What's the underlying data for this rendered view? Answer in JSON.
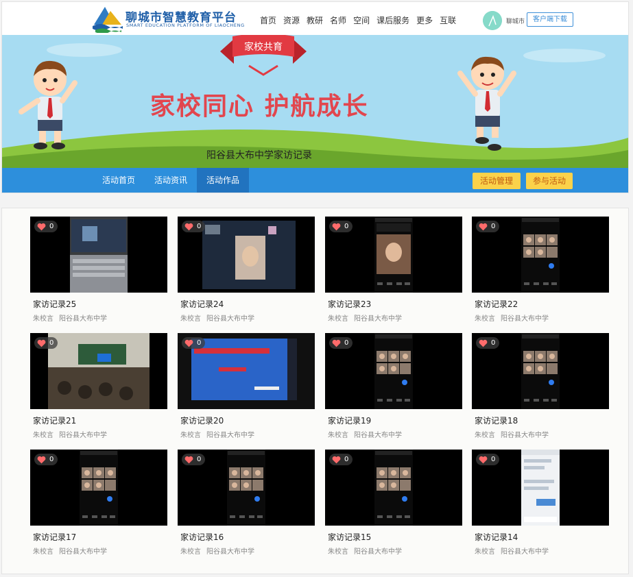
{
  "header": {
    "title": "聊城市智慧教育平台",
    "subtitle": "SMART EDUCATION PLATFORM OF LIAOCHENG",
    "nav": [
      "首页",
      "资源",
      "教研",
      "名师",
      "空间",
      "课后服务",
      "更多",
      "互联"
    ],
    "user_name": "聊城市",
    "download_label": "客户端下载"
  },
  "banner": {
    "ribbon": "家校共育",
    "title": "家校同心  护航成长",
    "subtitle": "阳谷县大布中学家访记录"
  },
  "activity_nav": {
    "tabs": [
      "活动首页",
      "活动资讯",
      "活动作品"
    ],
    "active_tab": "活动作品",
    "manage_label": "活动管理",
    "join_label": "参与活动"
  },
  "works": [
    {
      "title": "家访记录25",
      "author": "朱校言",
      "school": "阳谷县大布中学",
      "likes": "0",
      "thumb": "laptop"
    },
    {
      "title": "家访记录24",
      "author": "朱校言",
      "school": "阳谷县大布中学",
      "likes": "0",
      "thumb": "screen"
    },
    {
      "title": "家访记录23",
      "author": "朱校言",
      "school": "阳谷县大布中学",
      "likes": "0",
      "thumb": "phone-face"
    },
    {
      "title": "家访记录22",
      "author": "朱校言",
      "school": "阳谷县大布中学",
      "likes": "0",
      "thumb": "phone-grid"
    },
    {
      "title": "家访记录21",
      "author": "朱校言",
      "school": "阳谷县大布中学",
      "likes": "0",
      "thumb": "classroom"
    },
    {
      "title": "家访记录20",
      "author": "朱校言",
      "school": "阳谷县大布中学",
      "likes": "0",
      "thumb": "slide"
    },
    {
      "title": "家访记录19",
      "author": "朱校言",
      "school": "阳谷县大布中学",
      "likes": "0",
      "thumb": "phone-grid"
    },
    {
      "title": "家访记录18",
      "author": "朱校言",
      "school": "阳谷县大布中学",
      "likes": "0",
      "thumb": "phone-grid"
    },
    {
      "title": "家访记录17",
      "author": "朱校言",
      "school": "阳谷县大布中学",
      "likes": "0",
      "thumb": "phone-grid"
    },
    {
      "title": "家访记录16",
      "author": "朱校言",
      "school": "阳谷县大布中学",
      "likes": "0",
      "thumb": "phone-grid"
    },
    {
      "title": "家访记录15",
      "author": "朱校言",
      "school": "阳谷县大布中学",
      "likes": "0",
      "thumb": "phone-grid"
    },
    {
      "title": "家访记录14",
      "author": "朱校言",
      "school": "阳谷县大布中学",
      "likes": "0",
      "thumb": "phone-chat"
    }
  ],
  "colors": {
    "brand_blue": "#1f5fa8",
    "nav_bar": "#2d8fdc",
    "nav_active": "#2173bf",
    "button_yellow": "#fbd24a",
    "banner_red": "#e2464e",
    "like_heart": "#ff6b6b"
  },
  "icons": {
    "logo": "platform-logo-icon",
    "like": "heart-icon",
    "avatar": "user-avatar-icon"
  }
}
